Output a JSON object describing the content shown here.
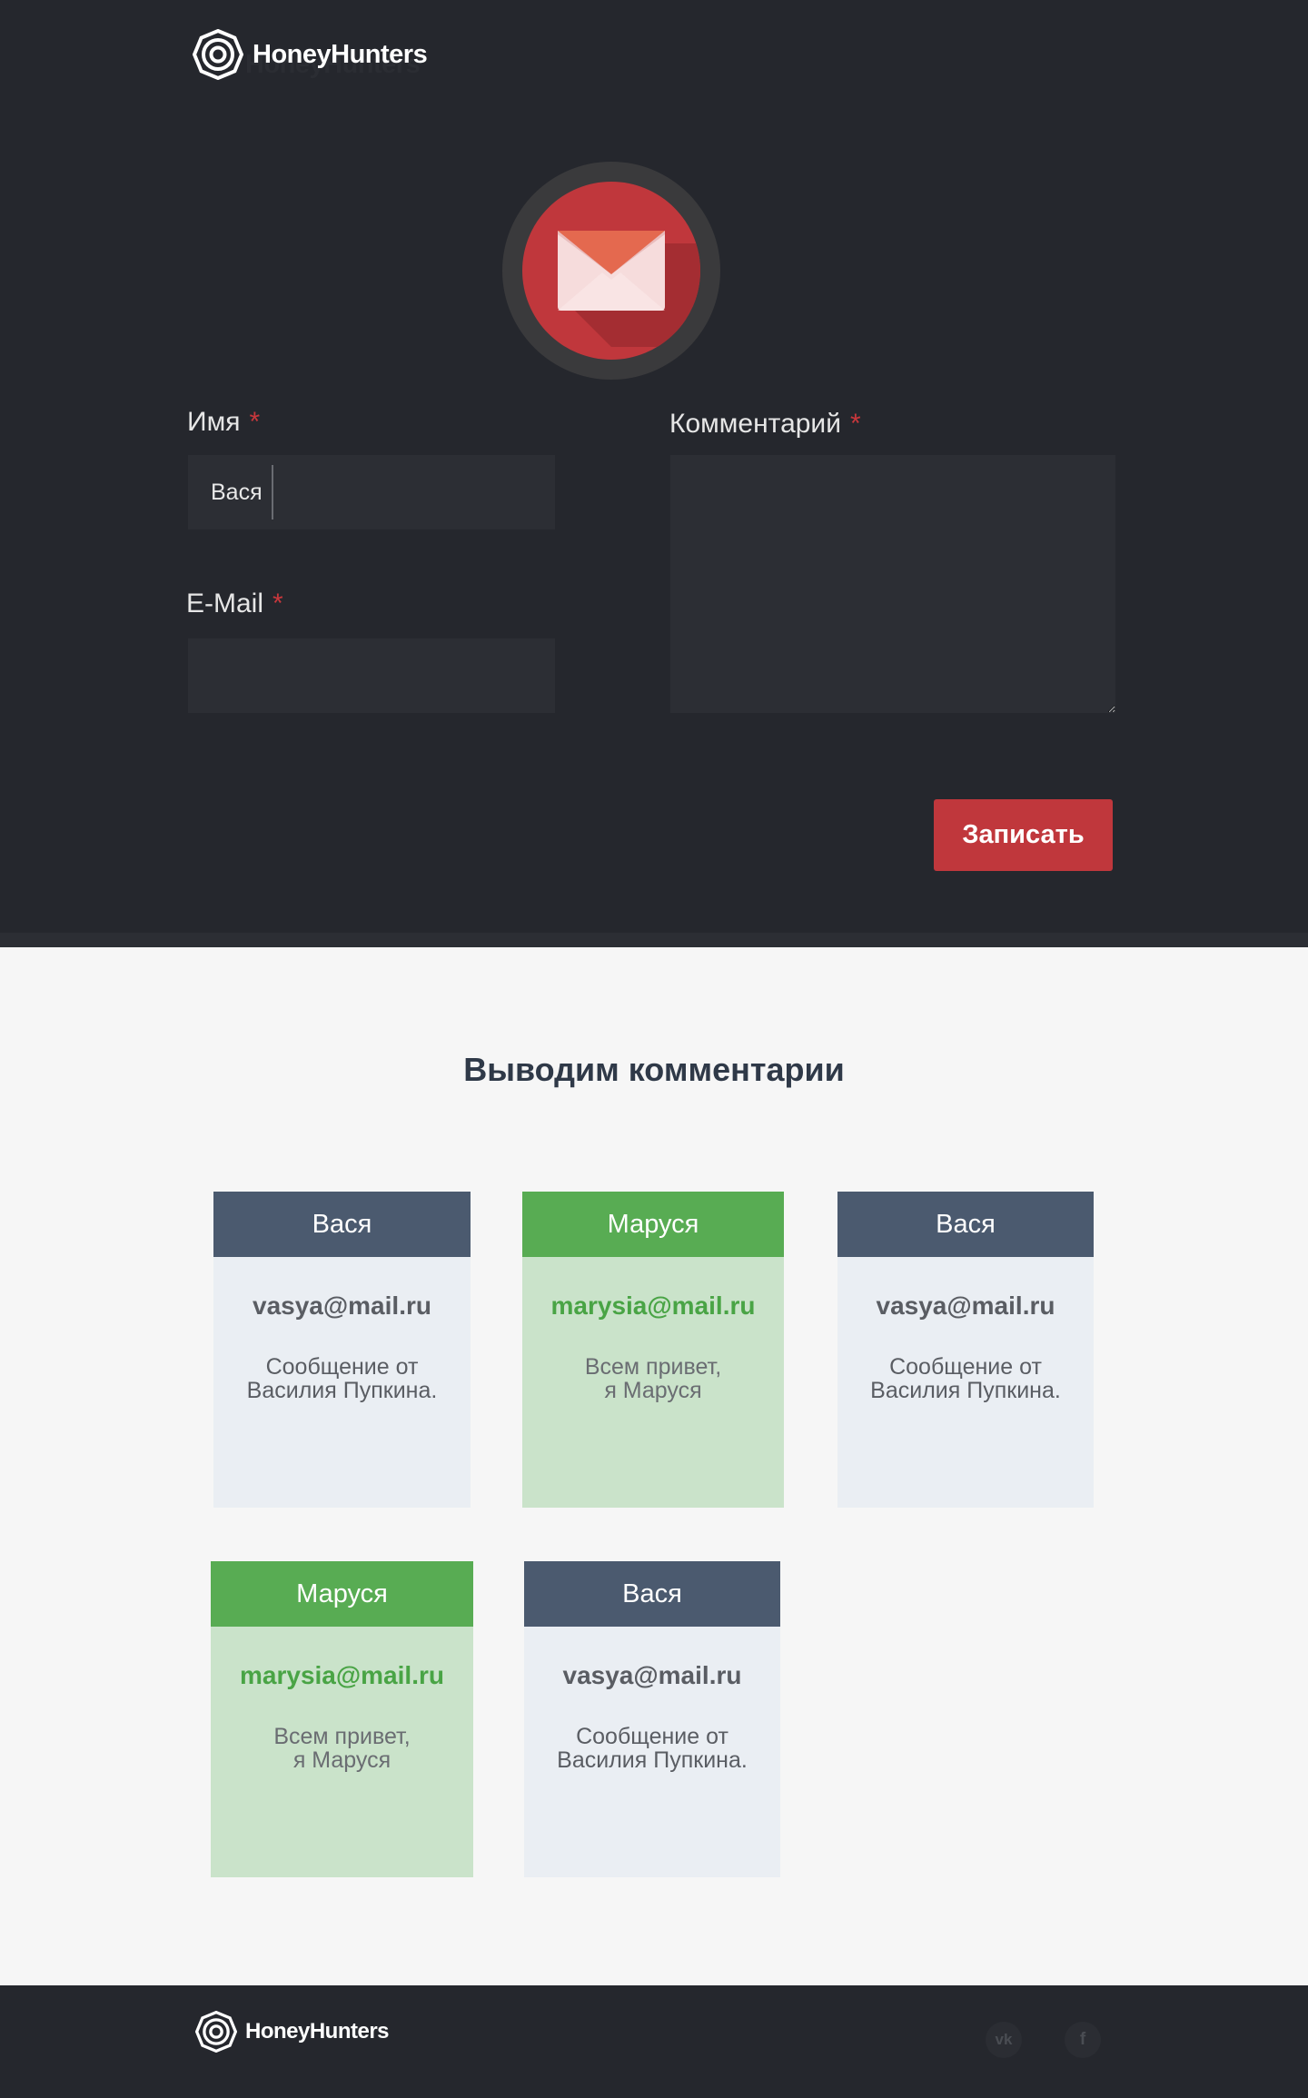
{
  "brand": {
    "name": "HoneyHunters"
  },
  "form": {
    "name": {
      "label": "Имя",
      "value": "Вася"
    },
    "email": {
      "label": "E-Mail",
      "value": ""
    },
    "comment": {
      "label": "Комментарий",
      "value": ""
    },
    "required_mark": "*",
    "submit_label": "Записать"
  },
  "comments_section": {
    "title": "Выводим комментарии",
    "cards": [
      {
        "name": "Вася",
        "email": "vasya@mail.ru",
        "message": "Сообщение от\nВасилия Пупкина.",
        "theme": "grey"
      },
      {
        "name": "Маруся",
        "email": "marysia@mail.ru",
        "message": "Всем привет,\nя Маруся",
        "theme": "green"
      },
      {
        "name": "Вася",
        "email": "vasya@mail.ru",
        "message": "Сообщение от\nВасилия Пупкина.",
        "theme": "grey"
      },
      {
        "name": "Маруся",
        "email": "marysia@mail.ru",
        "message": "Всем привет,\nя Маруся",
        "theme": "green"
      },
      {
        "name": "Вася",
        "email": "vasya@mail.ru",
        "message": "Сообщение от\nВасилия Пупкина.",
        "theme": "grey"
      }
    ]
  },
  "footer": {
    "social": [
      {
        "icon": "vk-icon",
        "label": "vk"
      },
      {
        "icon": "facebook-icon",
        "label": "f"
      }
    ]
  },
  "colors": {
    "dark_bg": "#25272d",
    "accent_red": "#c0373c",
    "card_grey_head": "#4b5a6f",
    "card_green_head": "#58ac53"
  }
}
